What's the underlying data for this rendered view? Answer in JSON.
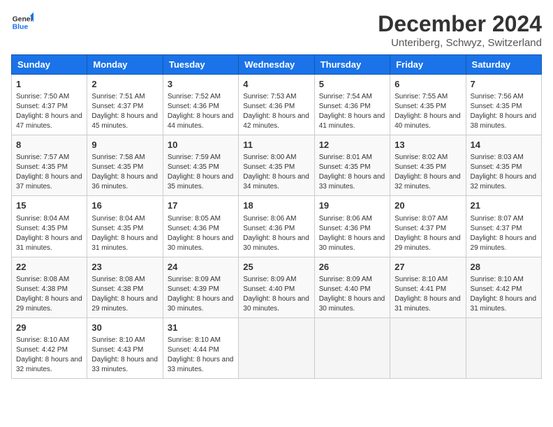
{
  "header": {
    "logo_line1": "General",
    "logo_line2": "Blue",
    "main_title": "December 2024",
    "subtitle": "Unteriberg, Schwyz, Switzerland"
  },
  "days_of_week": [
    "Sunday",
    "Monday",
    "Tuesday",
    "Wednesday",
    "Thursday",
    "Friday",
    "Saturday"
  ],
  "weeks": [
    [
      {
        "day": "1",
        "sunrise": "7:50 AM",
        "sunset": "4:37 PM",
        "daylight": "8 hours and 47 minutes."
      },
      {
        "day": "2",
        "sunrise": "7:51 AM",
        "sunset": "4:37 PM",
        "daylight": "8 hours and 45 minutes."
      },
      {
        "day": "3",
        "sunrise": "7:52 AM",
        "sunset": "4:36 PM",
        "daylight": "8 hours and 44 minutes."
      },
      {
        "day": "4",
        "sunrise": "7:53 AM",
        "sunset": "4:36 PM",
        "daylight": "8 hours and 42 minutes."
      },
      {
        "day": "5",
        "sunrise": "7:54 AM",
        "sunset": "4:36 PM",
        "daylight": "8 hours and 41 minutes."
      },
      {
        "day": "6",
        "sunrise": "7:55 AM",
        "sunset": "4:35 PM",
        "daylight": "8 hours and 40 minutes."
      },
      {
        "day": "7",
        "sunrise": "7:56 AM",
        "sunset": "4:35 PM",
        "daylight": "8 hours and 38 minutes."
      }
    ],
    [
      {
        "day": "8",
        "sunrise": "7:57 AM",
        "sunset": "4:35 PM",
        "daylight": "8 hours and 37 minutes."
      },
      {
        "day": "9",
        "sunrise": "7:58 AM",
        "sunset": "4:35 PM",
        "daylight": "8 hours and 36 minutes."
      },
      {
        "day": "10",
        "sunrise": "7:59 AM",
        "sunset": "4:35 PM",
        "daylight": "8 hours and 35 minutes."
      },
      {
        "day": "11",
        "sunrise": "8:00 AM",
        "sunset": "4:35 PM",
        "daylight": "8 hours and 34 minutes."
      },
      {
        "day": "12",
        "sunrise": "8:01 AM",
        "sunset": "4:35 PM",
        "daylight": "8 hours and 33 minutes."
      },
      {
        "day": "13",
        "sunrise": "8:02 AM",
        "sunset": "4:35 PM",
        "daylight": "8 hours and 32 minutes."
      },
      {
        "day": "14",
        "sunrise": "8:03 AM",
        "sunset": "4:35 PM",
        "daylight": "8 hours and 32 minutes."
      }
    ],
    [
      {
        "day": "15",
        "sunrise": "8:04 AM",
        "sunset": "4:35 PM",
        "daylight": "8 hours and 31 minutes."
      },
      {
        "day": "16",
        "sunrise": "8:04 AM",
        "sunset": "4:35 PM",
        "daylight": "8 hours and 31 minutes."
      },
      {
        "day": "17",
        "sunrise": "8:05 AM",
        "sunset": "4:36 PM",
        "daylight": "8 hours and 30 minutes."
      },
      {
        "day": "18",
        "sunrise": "8:06 AM",
        "sunset": "4:36 PM",
        "daylight": "8 hours and 30 minutes."
      },
      {
        "day": "19",
        "sunrise": "8:06 AM",
        "sunset": "4:36 PM",
        "daylight": "8 hours and 30 minutes."
      },
      {
        "day": "20",
        "sunrise": "8:07 AM",
        "sunset": "4:37 PM",
        "daylight": "8 hours and 29 minutes."
      },
      {
        "day": "21",
        "sunrise": "8:07 AM",
        "sunset": "4:37 PM",
        "daylight": "8 hours and 29 minutes."
      }
    ],
    [
      {
        "day": "22",
        "sunrise": "8:08 AM",
        "sunset": "4:38 PM",
        "daylight": "8 hours and 29 minutes."
      },
      {
        "day": "23",
        "sunrise": "8:08 AM",
        "sunset": "4:38 PM",
        "daylight": "8 hours and 29 minutes."
      },
      {
        "day": "24",
        "sunrise": "8:09 AM",
        "sunset": "4:39 PM",
        "daylight": "8 hours and 30 minutes."
      },
      {
        "day": "25",
        "sunrise": "8:09 AM",
        "sunset": "4:40 PM",
        "daylight": "8 hours and 30 minutes."
      },
      {
        "day": "26",
        "sunrise": "8:09 AM",
        "sunset": "4:40 PM",
        "daylight": "8 hours and 30 minutes."
      },
      {
        "day": "27",
        "sunrise": "8:10 AM",
        "sunset": "4:41 PM",
        "daylight": "8 hours and 31 minutes."
      },
      {
        "day": "28",
        "sunrise": "8:10 AM",
        "sunset": "4:42 PM",
        "daylight": "8 hours and 31 minutes."
      }
    ],
    [
      {
        "day": "29",
        "sunrise": "8:10 AM",
        "sunset": "4:42 PM",
        "daylight": "8 hours and 32 minutes."
      },
      {
        "day": "30",
        "sunrise": "8:10 AM",
        "sunset": "4:43 PM",
        "daylight": "8 hours and 33 minutes."
      },
      {
        "day": "31",
        "sunrise": "8:10 AM",
        "sunset": "4:44 PM",
        "daylight": "8 hours and 33 minutes."
      },
      null,
      null,
      null,
      null
    ]
  ],
  "labels": {
    "sunrise": "Sunrise:",
    "sunset": "Sunset:",
    "daylight": "Daylight:"
  }
}
